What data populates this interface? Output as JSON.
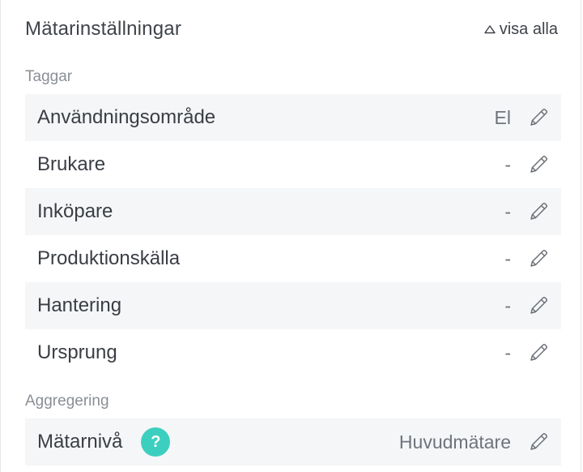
{
  "header": {
    "title": "Mätarinställningar",
    "toggle_label": "visa alla"
  },
  "tags_section": {
    "label": "Taggar",
    "rows": [
      {
        "label": "Användningsområde",
        "value": "El"
      },
      {
        "label": "Brukare",
        "value": "-"
      },
      {
        "label": "Inköpare",
        "value": "-"
      },
      {
        "label": "Produktionskälla",
        "value": "-"
      },
      {
        "label": "Hantering",
        "value": "-"
      },
      {
        "label": "Ursprung",
        "value": "-"
      }
    ]
  },
  "aggregation_section": {
    "label": "Aggregering",
    "rows": [
      {
        "label": "Mätarnivå",
        "value": "Huvudmätare",
        "help": "?"
      }
    ]
  },
  "colors": {
    "accent": "#3ccfc0",
    "row_shade": "#f5f6f8",
    "text": "#3a3e44",
    "muted": "#8a8f96"
  },
  "icons": {
    "edit": "pencil-icon",
    "toggle": "triangle-up-icon",
    "help": "help-icon"
  }
}
